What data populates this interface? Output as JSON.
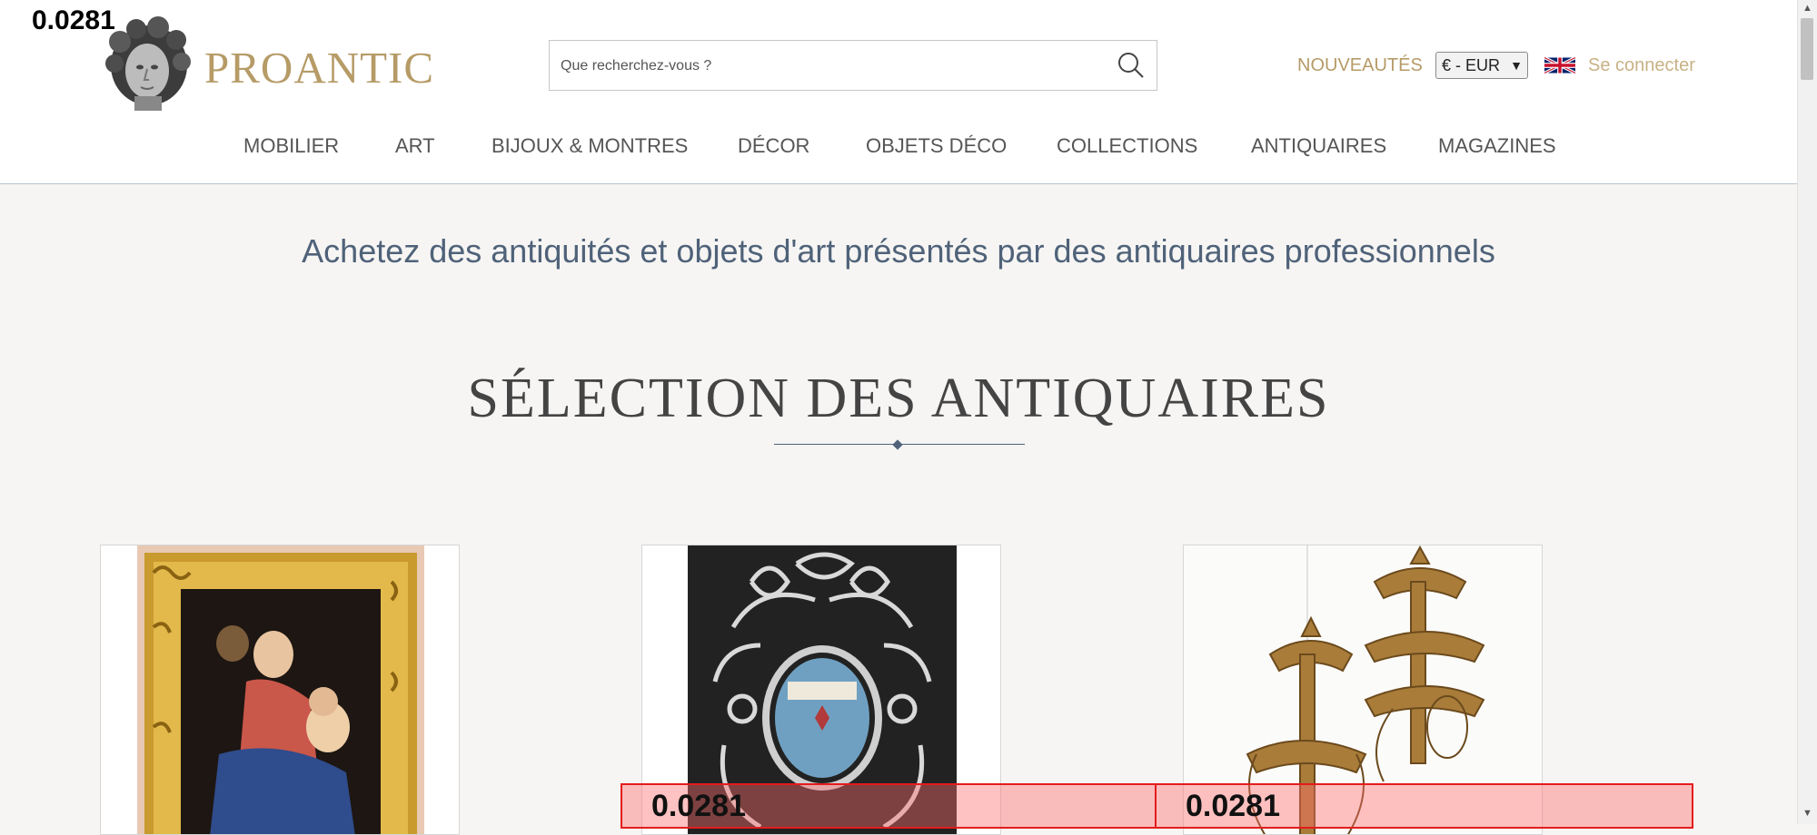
{
  "overlay": {
    "top_left_value": "0.0281",
    "box1_value": "0.0281",
    "box2_value": "0.0281"
  },
  "brand": {
    "name": "PROANTIC",
    "color": "#b69b67"
  },
  "search": {
    "placeholder": "Que recherchez-vous ?",
    "icon": "search-icon"
  },
  "header": {
    "nouveautes": "NOUVEAUTÉS",
    "currency": "€ - EUR",
    "language_flag": "uk-flag-icon",
    "login": "Se connecter"
  },
  "nav": {
    "items": [
      "MOBILIER",
      "ART",
      "BIJOUX & MONTRES",
      "DÉCOR",
      "OBJETS DÉCO",
      "COLLECTIONS",
      "ANTIQUAIRES",
      "MAGAZINES"
    ]
  },
  "main": {
    "tagline": "Achetez des antiquités et objets d'art présentés par des antiquaires professionnels",
    "section_title": "SÉLECTION DES ANTIQUAIRES"
  }
}
